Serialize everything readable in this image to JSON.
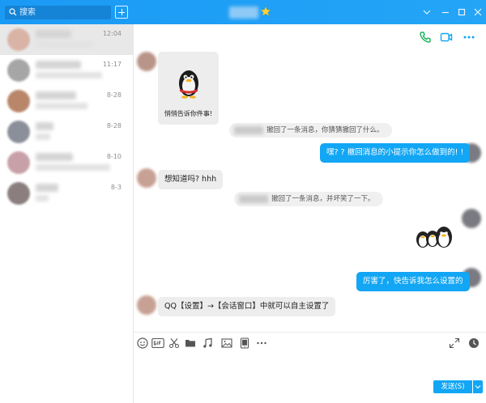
{
  "search": {
    "placeholder": "搜索"
  },
  "colors": {
    "accent": "#12a6f4",
    "title_bar": "#1a9af5"
  },
  "contacts": [
    {
      "time": "12:04",
      "avatar_color": "#d9b4a6"
    },
    {
      "time": "11:17",
      "avatar_color": "#a6a6a6"
    },
    {
      "time": "8-28",
      "avatar_color": "#b9866a"
    },
    {
      "time": "8-28",
      "avatar_color": "#8b8f9a"
    },
    {
      "time": "8-10",
      "avatar_color": "#c8a0a8"
    },
    {
      "time": "8-3",
      "avatar_color": "#8a7e7e"
    }
  ],
  "chat": {
    "card_caption": "悄悄告诉你件事!",
    "sys1": "撤回了一条消息，你猜猜撤回了什么。",
    "out1": "嘿? ? 撤回消息的小提示你怎么做到的! !",
    "in1": "想知道吗? hhh",
    "sys2": "撤回了一条消息，并坏笑了一下。",
    "out2": "厉害了，快告诉我怎么设置的",
    "in2": "QQ【设置】→【会话窗口】中就可以自主设置了"
  },
  "toolbar": {
    "icons": [
      "emoji-icon",
      "gif-icon",
      "scissors-icon",
      "folder-icon",
      "music-icon",
      "image-icon",
      "phone-screen-icon",
      "more-icon"
    ]
  },
  "input": {
    "send_label": "发送(S)"
  }
}
